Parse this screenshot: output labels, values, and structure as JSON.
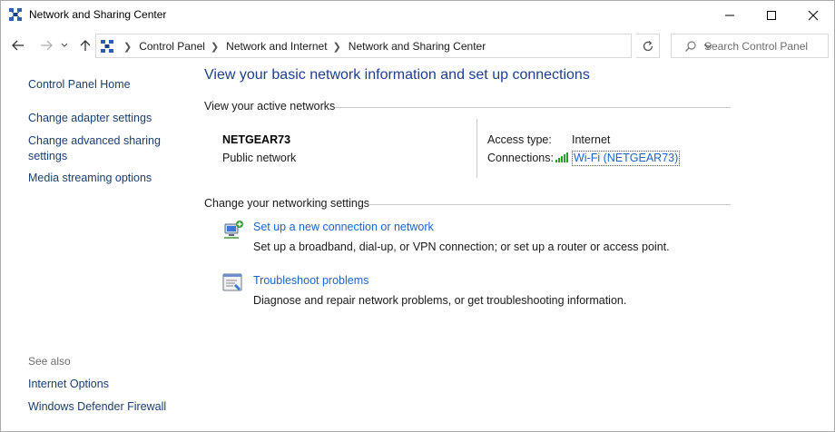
{
  "window": {
    "title": "Network and Sharing Center"
  },
  "address": {
    "breadcrumbs": [
      "Control Panel",
      "Network and Internet",
      "Network and Sharing Center"
    ]
  },
  "search": {
    "placeholder": "Search Control Panel"
  },
  "sidebar": {
    "home": "Control Panel Home",
    "items": [
      "Change adapter settings",
      "Change advanced sharing settings",
      "Media streaming options"
    ],
    "see_also_label": "See also",
    "see_also": [
      "Internet Options",
      "Windows Defender Firewall"
    ]
  },
  "main": {
    "title": "View your basic network information and set up connections",
    "active_networks_heading": "View your active networks",
    "network": {
      "name": "NETGEAR73",
      "category": "Public network",
      "access_type_label": "Access type:",
      "access_type_value": "Internet",
      "connections_label": "Connections:",
      "connection_link": "Wi-Fi (NETGEAR73)"
    },
    "change_heading": "Change your networking settings",
    "tasks": [
      {
        "link": "Set up a new connection or network",
        "description": "Set up a broadband, dial-up, or VPN connection; or set up a router or access point."
      },
      {
        "link": "Troubleshoot problems",
        "description": "Diagnose and repair network problems, or get troubleshooting information."
      }
    ]
  },
  "colors": {
    "heading_blue": "#1e3d8f",
    "link_blue": "#1e62c8",
    "signal_green": "#2e9e2e"
  }
}
